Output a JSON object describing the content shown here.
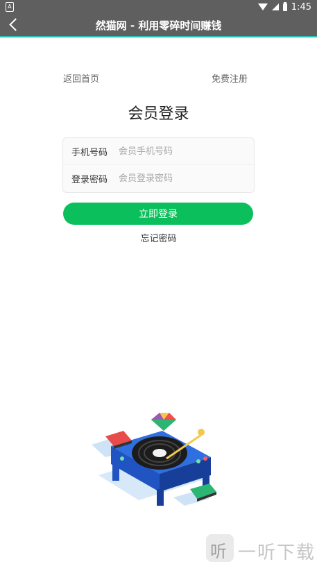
{
  "status_bar": {
    "left_icon": "a-box-icon",
    "left_label": "A",
    "time": "1:45"
  },
  "app_bar": {
    "title": "然猫网 - 利用零碎时间赚钱"
  },
  "top_links": {
    "back_home": "返回首页",
    "register": "免费注册"
  },
  "page": {
    "title": "会员登录"
  },
  "form": {
    "phone": {
      "label": "手机号码",
      "placeholder": "会员手机号码",
      "value": ""
    },
    "password": {
      "label": "登录密码",
      "placeholder": "会员登录密码",
      "value": ""
    }
  },
  "actions": {
    "login_label": "立即登录",
    "forgot_label": "忘记密码"
  },
  "watermark": {
    "badge_glyph": "听",
    "text": "一听下载"
  },
  "colors": {
    "status_bar": "#5f5f5f",
    "accent_line": "#28c2b5",
    "login_button": "#0bc05c"
  }
}
